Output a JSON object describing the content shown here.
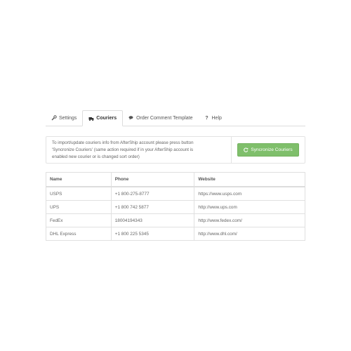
{
  "tabs": [
    {
      "label": "Settings",
      "icon": "wrench-icon"
    },
    {
      "label": "Couriers",
      "icon": "truck-icon",
      "active": true
    },
    {
      "label": "Order Comment Template",
      "icon": "comments-icon"
    },
    {
      "label": "Help",
      "icon": "question-icon"
    }
  ],
  "info": {
    "lines": [
      "To import/update couriers info from AfterShip account please press button",
      "'Syncronize Couriers' (same action required if in your AfterShip account is",
      "enabled new courier or is changed sort order)"
    ],
    "button_label": "Syncronize Couriers"
  },
  "table": {
    "headers": [
      "Name",
      "Phone",
      "Website"
    ],
    "rows": [
      [
        "USPS",
        "+1 800-275-8777",
        "https://www.usps.com"
      ],
      [
        "UPS",
        "+1 800 742 5877",
        "http://www.ups.com"
      ],
      [
        "FedEx",
        "18004194343",
        "http://www.fedex.com/"
      ],
      [
        "DHL Express",
        "+1 800 225 5345",
        "http://www.dhl.com/"
      ]
    ]
  },
  "colors": {
    "accent_button": "#7fbf6b",
    "border": "#dddddd"
  }
}
